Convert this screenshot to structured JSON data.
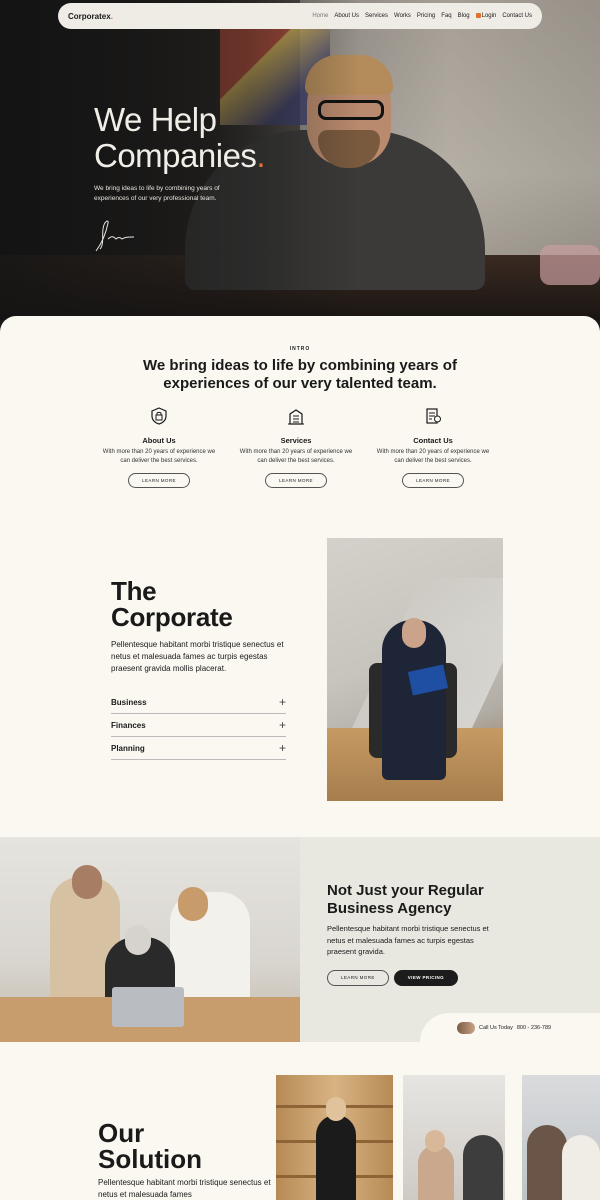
{
  "nav": {
    "logo": "Corporatex",
    "logo_dot": ".",
    "items": [
      "Home",
      "About Us",
      "Services",
      "Works",
      "Pricing",
      "Faq",
      "Blog",
      "Login",
      "Contact Us"
    ]
  },
  "hero": {
    "title_line1": "We Help",
    "title_line2": "Companies",
    "title_dot": ".",
    "subtitle": "We bring ideas to life by combining years of experiences of our very professional team."
  },
  "intro": {
    "label": "INTRO",
    "title": "We bring ideas to life by combining years of experiences of our very talented team.",
    "features": [
      {
        "title": "About Us",
        "desc": "With more than 20 years of experience we can deliver the best services.",
        "button": "LEARN MORE",
        "icon": "shield-lock-icon"
      },
      {
        "title": "Services",
        "desc": "With more than 20 years of experience we can deliver the best services.",
        "button": "LEARN MORE",
        "icon": "building-icon"
      },
      {
        "title": "Contact Us",
        "desc": "With more than 20 years of experience we can deliver the best services.",
        "button": "LEARN MORE",
        "icon": "document-edit-icon"
      }
    ]
  },
  "corporate": {
    "title_line1": "The",
    "title_line2": "Corporate",
    "desc": "Pellentesque habitant morbi tristique senectus et netus et malesuada fames ac turpis egestas praesent gravida mollis placerat.",
    "accordion": [
      "Business",
      "Finances",
      "Planning"
    ]
  },
  "agency": {
    "title": "Not Just your Regular Business Agency",
    "desc": "Pellentesque habitant morbi tristique senectus et netus et malesuada fames ac turpis egestas praesent gravida.",
    "btn_learn": "LEARN MORE",
    "btn_pricing": "VIEW PRICING",
    "call_label": "Call Us Today",
    "call_number": "800 - 236-789"
  },
  "solution": {
    "title_line1": "Our",
    "title_line2": "Solution",
    "desc": "Pellentesque habitant morbi tristique senectus et netus et malesuada fames"
  },
  "colors": {
    "accent": "#e2702e",
    "panel_bg": "#faf8f1",
    "dark": "#1c1c1c"
  }
}
